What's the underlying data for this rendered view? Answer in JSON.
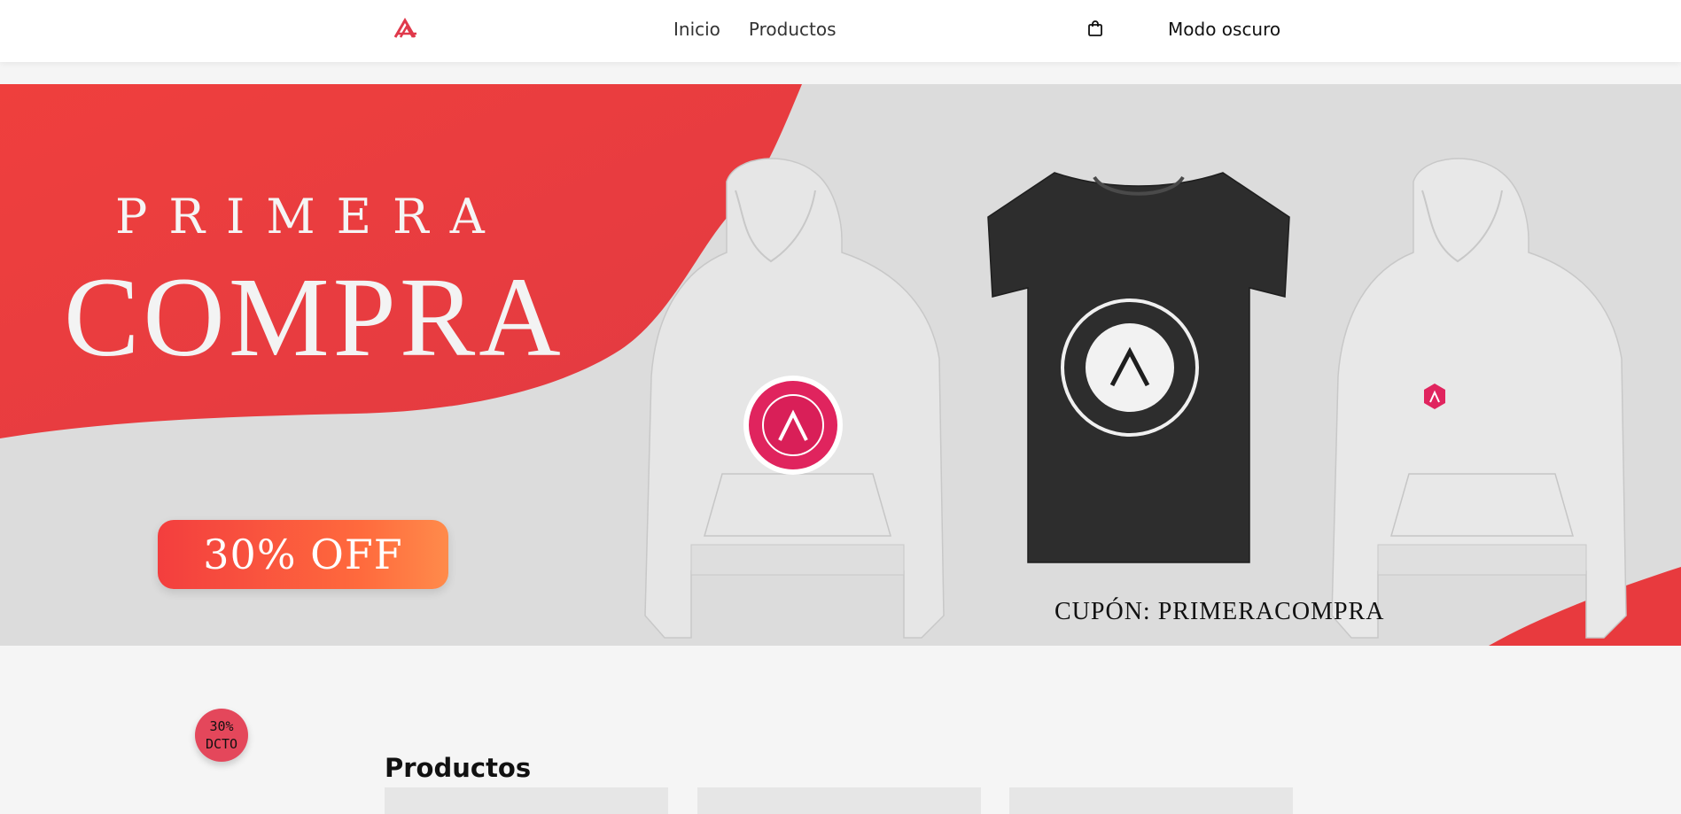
{
  "navbar": {
    "logo_icon": "academia-a-logo",
    "links": [
      {
        "label": "Inicio"
      },
      {
        "label": "Productos"
      }
    ],
    "cart_icon": "shopping-bag-icon",
    "dark_mode_label": "Modo oscuro"
  },
  "hero": {
    "line1": "PRIMERA",
    "line2": "COMPRA",
    "badge": "30% OFF",
    "coupon": "CUPÓN: PRIMERACOMPRA",
    "garments": [
      {
        "type": "hoodie",
        "color": "#e2e2e2",
        "emblem": "large-circle-badge"
      },
      {
        "type": "tshirt",
        "color": "#2b2b2b",
        "emblem": "circle-badge"
      },
      {
        "type": "hoodie",
        "color": "#e2e2e2",
        "emblem": "small-hex-badge"
      }
    ],
    "colors": {
      "accent": "#ef4040",
      "accent2": "#ff8b4b",
      "bg": "#dcdcdc",
      "pink": "#e0245e"
    }
  },
  "discount_bubble": {
    "line1": "30%",
    "line2": "DCTO"
  },
  "products": {
    "title": "Productos",
    "cards": [
      {},
      {},
      {}
    ]
  }
}
